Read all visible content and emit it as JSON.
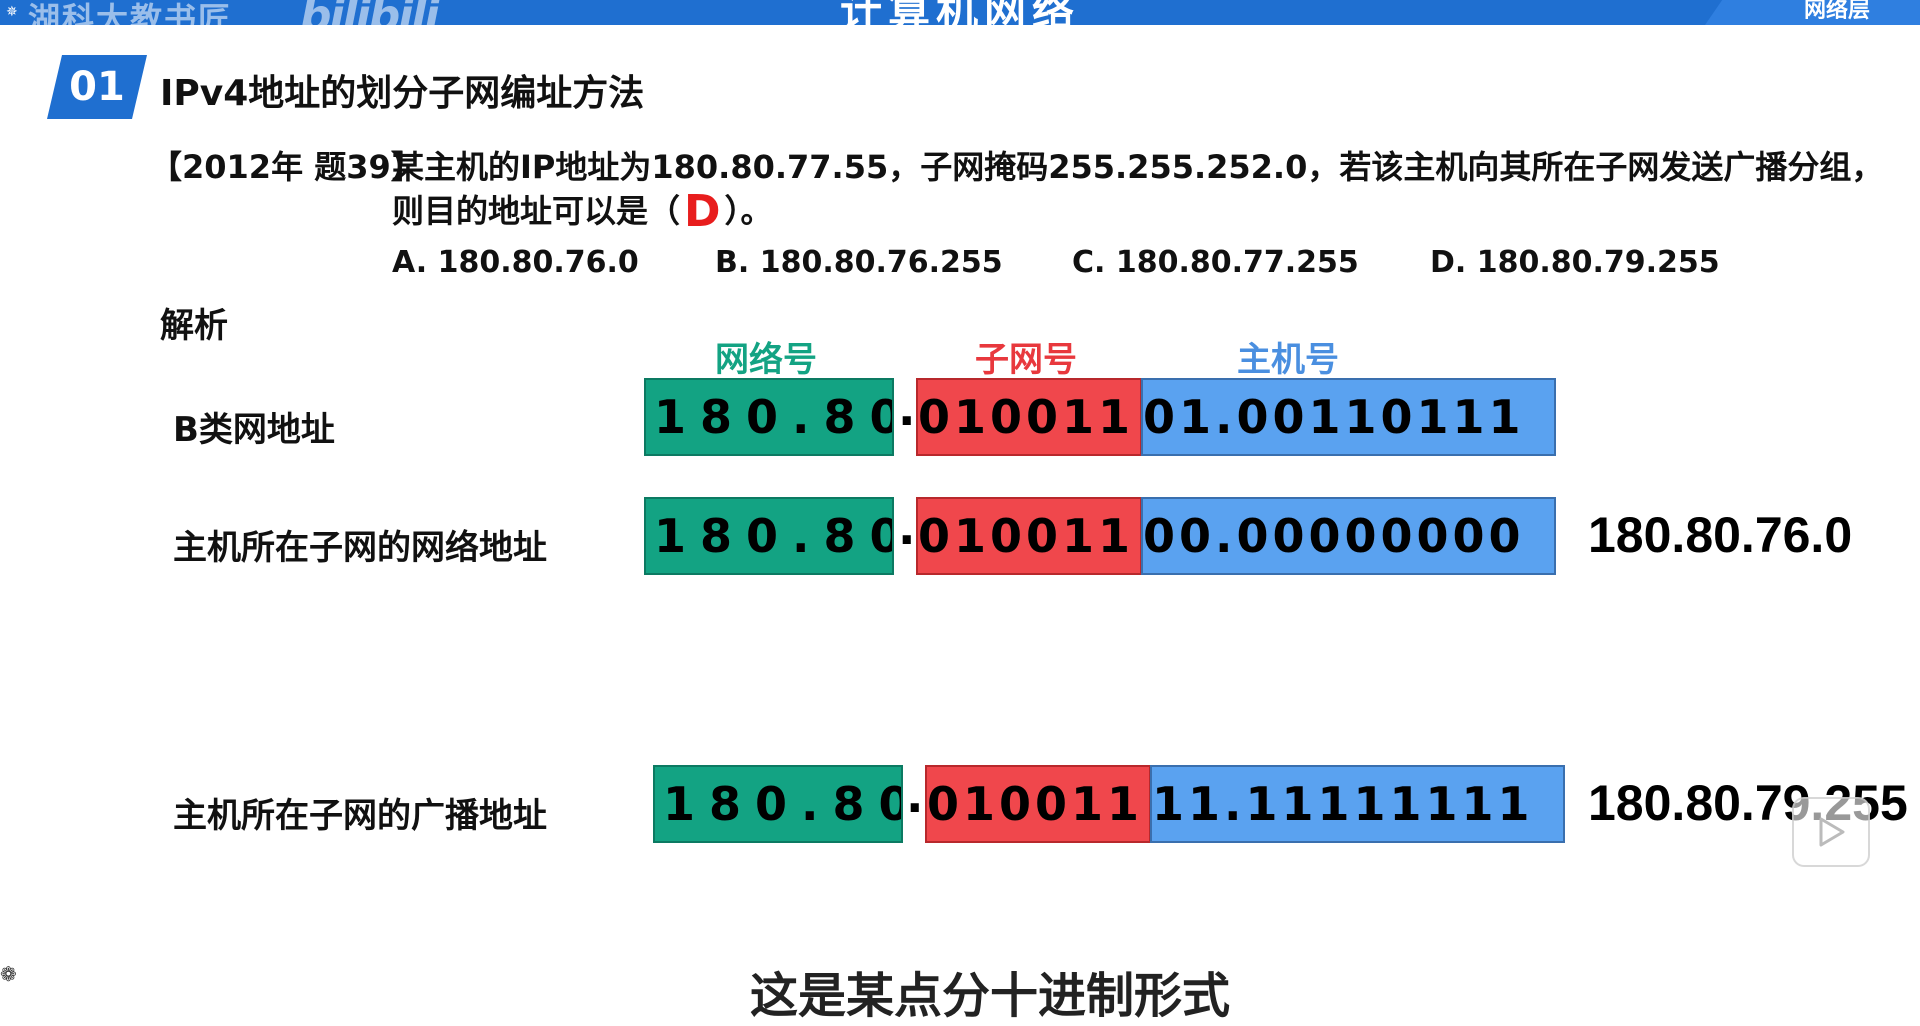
{
  "header": {
    "left_text": "湖科大教书匠",
    "watermark": "bilibili",
    "center_title": "计算机网络",
    "right_label": "网络层"
  },
  "section": {
    "number": "01",
    "title": "IPv4地址的划分子网编址方法"
  },
  "question": {
    "tag": "【2012年 题39】",
    "line1": "某主机的IP地址为180.80.77.55，子网掩码255.255.252.0，若该主机向其所在子网发送广播分组，",
    "line2_before": "则目的地址可以是（",
    "answer": "D",
    "line2_after": "）。",
    "options": [
      "A. 180.80.76.0",
      "B. 180.80.76.255",
      "C. 180.80.77.255",
      "D. 180.80.79.255"
    ]
  },
  "analysis": {
    "label": "解析",
    "legend": {
      "network": "网络号",
      "subnet": "子网号",
      "host": "主机号"
    },
    "rows": [
      {
        "label": "B类网地址",
        "network": "180.80",
        "subnet": "010011",
        "host": "01.00110111",
        "result": ""
      },
      {
        "label": "主机所在子网的网络地址",
        "network": "180.80",
        "subnet": "010011",
        "host": "00.00000000",
        "result": "180.80.76.0"
      },
      {
        "label": "主机所在子网的广播地址",
        "network": "180.80",
        "subnet": "010011",
        "host": "11.11111111",
        "result": "180.80.79.255"
      }
    ]
  },
  "colors": {
    "header_blue": "#1f6fd0",
    "network_green": "#13a383",
    "subnet_red": "#f0474c",
    "host_blue": "#5aa2f0",
    "answer_red": "#e81d1d"
  },
  "subtitle": "这是某点分十进制形式"
}
